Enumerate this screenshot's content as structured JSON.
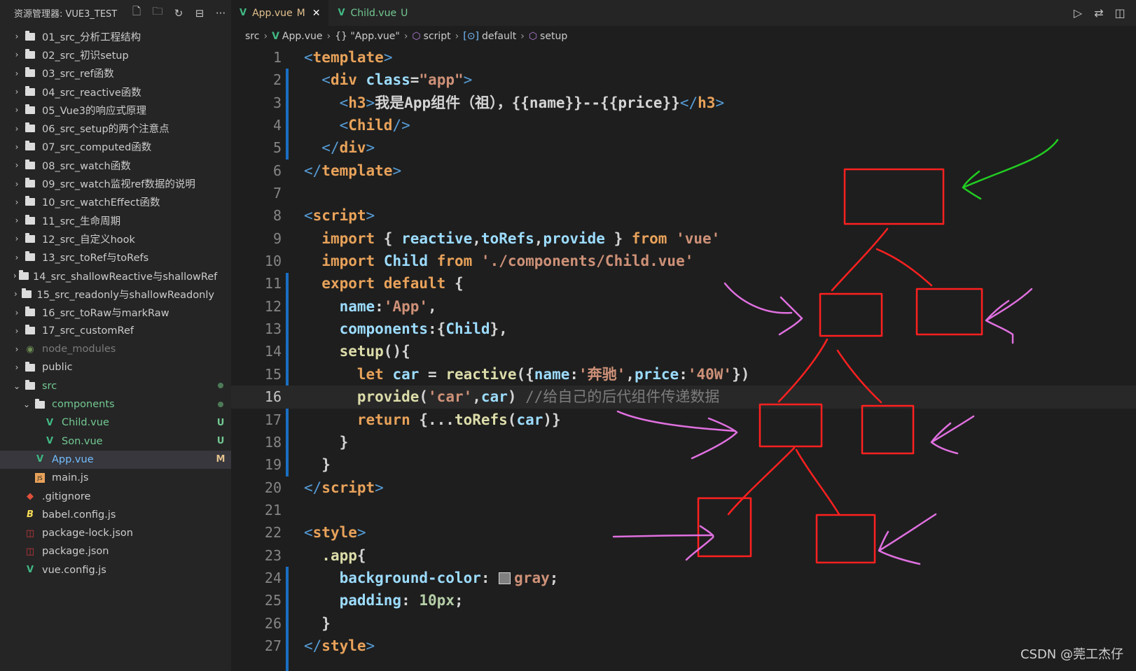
{
  "explorer": {
    "title": "资源管理器: VUE3_TEST",
    "items": [
      {
        "label": "01_src_分析工程结构",
        "kind": "folder",
        "chevron": "›"
      },
      {
        "label": "02_src_初识setup",
        "kind": "folder",
        "chevron": "›"
      },
      {
        "label": "03_src_ref函数",
        "kind": "folder",
        "chevron": "›"
      },
      {
        "label": "04_src_reactive函数",
        "kind": "folder",
        "chevron": "›"
      },
      {
        "label": "05_Vue3的响应式原理",
        "kind": "folder",
        "chevron": "›"
      },
      {
        "label": "06_src_setup的两个注意点",
        "kind": "folder",
        "chevron": "›"
      },
      {
        "label": "07_src_computed函数",
        "kind": "folder",
        "chevron": "›"
      },
      {
        "label": "08_src_watch函数",
        "kind": "folder",
        "chevron": "›"
      },
      {
        "label": "09_src_watch监视ref数据的说明",
        "kind": "folder",
        "chevron": "›"
      },
      {
        "label": "10_src_watchEffect函数",
        "kind": "folder",
        "chevron": "›"
      },
      {
        "label": "11_src_生命周期",
        "kind": "folder",
        "chevron": "›"
      },
      {
        "label": "12_src_自定义hook",
        "kind": "folder",
        "chevron": "›"
      },
      {
        "label": "13_src_toRef与toRefs",
        "kind": "folder",
        "chevron": "›"
      },
      {
        "label": "14_src_shallowReactive与shallowRef",
        "kind": "folder",
        "chevron": "›"
      },
      {
        "label": "15_src_readonly与shallowReadonly",
        "kind": "folder",
        "chevron": "›"
      },
      {
        "label": "16_src_toRaw与markRaw",
        "kind": "folder",
        "chevron": "›"
      },
      {
        "label": "17_src_customRef",
        "kind": "folder",
        "chevron": "›"
      },
      {
        "label": "node_modules",
        "kind": "node_modules",
        "chevron": "›"
      },
      {
        "label": "public",
        "kind": "folder",
        "chevron": "›"
      },
      {
        "label": "src",
        "kind": "folder-open",
        "chevron": "⌄",
        "status": "dot"
      },
      {
        "label": "components",
        "kind": "folder-open",
        "chevron": "⌄",
        "indent": 1,
        "status": "dot"
      },
      {
        "label": "Child.vue",
        "kind": "vue",
        "indent": 2,
        "status": "U"
      },
      {
        "label": "Son.vue",
        "kind": "vue",
        "indent": 2,
        "status": "U"
      },
      {
        "label": "App.vue",
        "kind": "vue",
        "indent": 1,
        "status": "M",
        "selected": true
      },
      {
        "label": "main.js",
        "kind": "js",
        "indent": 1
      },
      {
        "label": ".gitignore",
        "kind": "git"
      },
      {
        "label": "babel.config.js",
        "kind": "babel"
      },
      {
        "label": "package-lock.json",
        "kind": "npm"
      },
      {
        "label": "package.json",
        "kind": "npm"
      },
      {
        "label": "vue.config.js",
        "kind": "vue"
      }
    ]
  },
  "tabs": [
    {
      "label": "App.vue",
      "status": "M",
      "active": true
    },
    {
      "label": "Child.vue",
      "status": "U",
      "active": false
    }
  ],
  "breadcrumb": [
    "src",
    "App.vue",
    "{} \"App.vue\"",
    "script",
    "default",
    "setup"
  ],
  "editor": {
    "current_line": 16,
    "lines": [
      [
        [
          "t-tag",
          "<"
        ],
        [
          "t-tagname",
          "template"
        ],
        [
          "t-tag",
          ">"
        ]
      ],
      [
        [
          "",
          "  "
        ],
        [
          "t-tag",
          "<"
        ],
        [
          "t-tagname",
          "div"
        ],
        [
          "",
          ""
        ],
        [
          "t-attr",
          " class"
        ],
        [
          "t-plain",
          "="
        ],
        [
          "t-str",
          "\"app\""
        ],
        [
          "t-tag",
          ">"
        ]
      ],
      [
        [
          "",
          "    "
        ],
        [
          "t-tag",
          "<"
        ],
        [
          "t-tagname",
          "h3"
        ],
        [
          "t-tag",
          ">"
        ],
        [
          "t-plain",
          "我是App组件（祖），{{name}}--{{price}}"
        ],
        [
          "t-tag",
          "</"
        ],
        [
          "t-tagname",
          "h3"
        ],
        [
          "t-tag",
          ">"
        ]
      ],
      [
        [
          "",
          "    "
        ],
        [
          "t-tag",
          "<"
        ],
        [
          "t-tagname",
          "Child"
        ],
        [
          "t-tag",
          "/>"
        ]
      ],
      [
        [
          "",
          "  "
        ],
        [
          "t-tag",
          "</"
        ],
        [
          "t-tagname",
          "div"
        ],
        [
          "t-tag",
          ">"
        ]
      ],
      [
        [
          "t-tag",
          "</"
        ],
        [
          "t-tagname",
          "template"
        ],
        [
          "t-tag",
          ">"
        ]
      ],
      [],
      [
        [
          "t-tag",
          "<"
        ],
        [
          "t-tagname",
          "script"
        ],
        [
          "t-tag",
          ">"
        ]
      ],
      [
        [
          "",
          "  "
        ],
        [
          "t-kw",
          "import"
        ],
        [
          "t-plain",
          " { "
        ],
        [
          "t-id",
          "reactive"
        ],
        [
          "t-plain",
          ","
        ],
        [
          "t-id",
          "toRefs"
        ],
        [
          "t-plain",
          ","
        ],
        [
          "t-id",
          "provide"
        ],
        [
          "t-plain",
          " } "
        ],
        [
          "t-kw",
          "from"
        ],
        [
          "t-plain",
          " "
        ],
        [
          "t-str",
          "'vue'"
        ]
      ],
      [
        [
          "",
          "  "
        ],
        [
          "t-kw",
          "import"
        ],
        [
          "t-plain",
          " "
        ],
        [
          "t-id",
          "Child"
        ],
        [
          "t-plain",
          " "
        ],
        [
          "t-kw",
          "from"
        ],
        [
          "t-plain",
          " "
        ],
        [
          "t-str",
          "'./components/Child.vue'"
        ]
      ],
      [
        [
          "",
          "  "
        ],
        [
          "t-kw",
          "export"
        ],
        [
          "t-plain",
          " "
        ],
        [
          "t-kw",
          "default"
        ],
        [
          "t-plain",
          " {"
        ]
      ],
      [
        [
          "",
          "    "
        ],
        [
          "t-id",
          "name"
        ],
        [
          "t-plain",
          ":"
        ],
        [
          "t-str",
          "'App'"
        ],
        [
          "t-plain",
          ","
        ]
      ],
      [
        [
          "",
          "    "
        ],
        [
          "t-id",
          "components"
        ],
        [
          "t-plain",
          ":{"
        ],
        [
          "t-id",
          "Child"
        ],
        [
          "t-plain",
          "},"
        ]
      ],
      [
        [
          "",
          "    "
        ],
        [
          "t-fn",
          "setup"
        ],
        [
          "t-plain",
          "(){"
        ]
      ],
      [
        [
          "",
          "      "
        ],
        [
          "t-kw",
          "let"
        ],
        [
          "t-plain",
          " "
        ],
        [
          "t-id",
          "car"
        ],
        [
          "t-plain",
          " = "
        ],
        [
          "t-fn",
          "reactive"
        ],
        [
          "t-plain",
          "({"
        ],
        [
          "t-id",
          "name"
        ],
        [
          "t-plain",
          ":"
        ],
        [
          "t-str",
          "'奔驰'"
        ],
        [
          "t-plain",
          ","
        ],
        [
          "t-id",
          "price"
        ],
        [
          "t-plain",
          ":"
        ],
        [
          "t-str",
          "'40W'"
        ],
        [
          "t-plain",
          "})"
        ]
      ],
      [
        [
          "",
          "      "
        ],
        [
          "t-fn",
          "provide"
        ],
        [
          "t-plain",
          "("
        ],
        [
          "t-str",
          "'car'"
        ],
        [
          "t-plain",
          ","
        ],
        [
          "t-id",
          "car"
        ],
        [
          "t-plain",
          ") "
        ],
        [
          "t-comment",
          "//给自己的后代组件传递数据"
        ]
      ],
      [
        [
          "",
          "      "
        ],
        [
          "t-kw",
          "return"
        ],
        [
          "t-plain",
          " {..."
        ],
        [
          "t-fn",
          "toRefs"
        ],
        [
          "t-plain",
          "("
        ],
        [
          "t-id",
          "car"
        ],
        [
          "t-plain",
          ")}"
        ]
      ],
      [
        [
          "",
          "    "
        ],
        [
          "t-plain",
          "}"
        ]
      ],
      [
        [
          "",
          "  "
        ],
        [
          "t-plain",
          "}"
        ]
      ],
      [
        [
          "t-tag",
          "</"
        ],
        [
          "t-tagname",
          "script"
        ],
        [
          "t-tag",
          ">"
        ]
      ],
      [],
      [
        [
          "t-tag",
          "<"
        ],
        [
          "t-tagname",
          "style"
        ],
        [
          "t-tag",
          ">"
        ]
      ],
      [
        [
          "",
          "  "
        ],
        [
          "t-fn",
          ".app"
        ],
        [
          "t-plain",
          "{"
        ]
      ],
      [
        [
          "",
          "    "
        ],
        [
          "t-id",
          "background-color"
        ],
        [
          "t-plain",
          ": "
        ],
        [
          "swatch",
          ""
        ],
        [
          "t-str",
          "gray"
        ],
        [
          "t-plain",
          ";"
        ]
      ],
      [
        [
          "",
          "    "
        ],
        [
          "t-id",
          "padding"
        ],
        [
          "t-plain",
          ": "
        ],
        [
          "t-num",
          "10px"
        ],
        [
          "t-plain",
          ";"
        ]
      ],
      [
        [
          "",
          "  "
        ],
        [
          "t-plain",
          "}"
        ]
      ],
      [
        [
          "t-tag",
          "</"
        ],
        [
          "t-tagname",
          "style"
        ],
        [
          "t-tag",
          ">"
        ]
      ]
    ]
  },
  "colors": {
    "vue_green": "#41b883",
    "untracked": "#73c991",
    "modified": "#e2c08d",
    "annotation_red": "#ff2020",
    "annotation_pink": "#e070e0",
    "annotation_green": "#22cc22"
  },
  "watermark": "CSDN @莞工杰仔"
}
